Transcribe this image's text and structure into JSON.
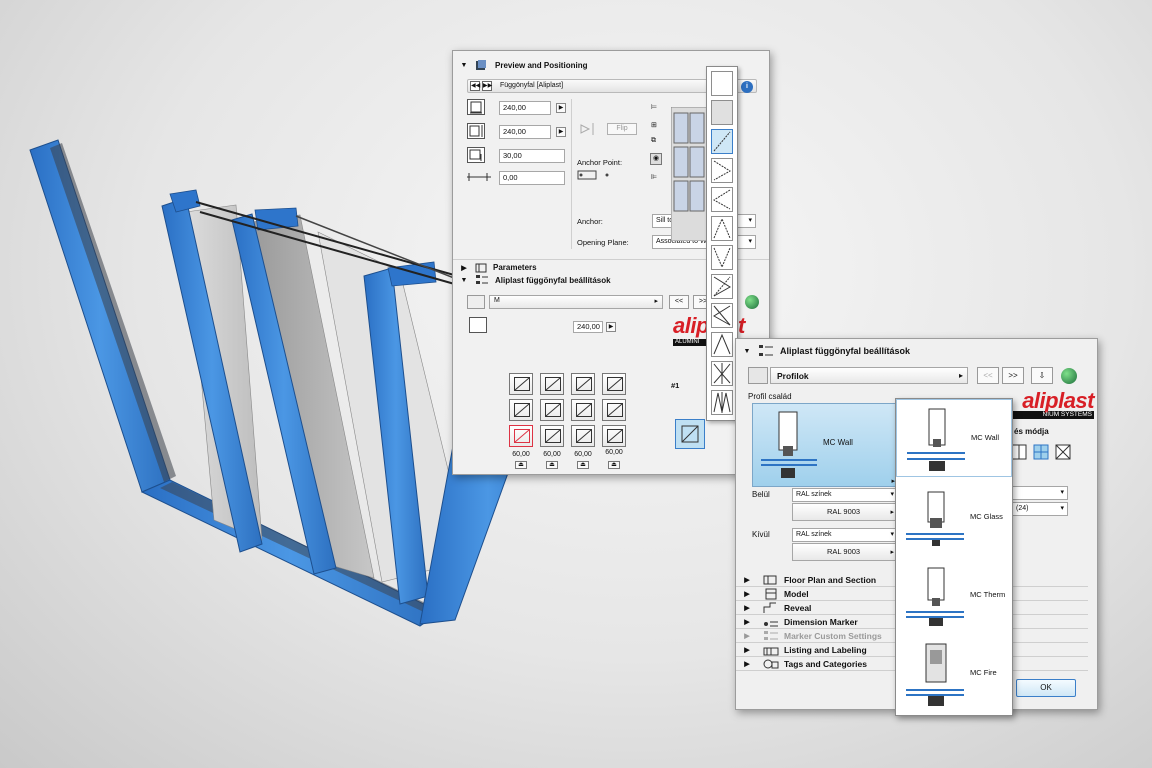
{
  "panel1": {
    "section_title": "Preview and Positioning",
    "object_name": "Függönyfal [Aliplast]",
    "width_value": "240,00",
    "height_value": "240,00",
    "depth_value": "30,00",
    "offset_value": "0,00",
    "flip_label": "Flip",
    "anchor_point_label": "Anchor Point:",
    "anchor_label": "Anchor:",
    "anchor_value": "Sill to Wall base",
    "opening_plane_label": "Opening Plane:",
    "opening_plane_value": "Associated to W",
    "parameters_label": "Parameters",
    "aliplast_settings_label": "Aliplast függönyfal beállítások",
    "height_small_value": "240,00",
    "dropdown_short": "M",
    "prev_label": "<<",
    "next_label": ">>",
    "column_widths": [
      "60,00",
      "60,00",
      "60,00",
      "60,00"
    ],
    "cell_id": "#1"
  },
  "panel2": {
    "section_title": "Aliplast függönyfal beállítások",
    "page_dropdown": "Profilok",
    "prev_label": "<<",
    "next_label": ">>",
    "profile_family_label": "Profil család",
    "selected_profile": "MC Wall",
    "inside_label": "Belül",
    "outside_label": "Kívül",
    "inside_color_set": "RAL színek",
    "inside_color": "RAL 9003",
    "outside_color_set": "RAL színek",
    "outside_color": "RAL 9003",
    "opening_mode_label_partial": "és módja",
    "partial_value": "(24)",
    "logo_text": "aliplast",
    "logo_sub": "NIUM SYSTEMS",
    "ok_label": "OK",
    "sections": [
      {
        "label": "Floor Plan and Section",
        "disabled": false
      },
      {
        "label": "Model",
        "disabled": false
      },
      {
        "label": "Reveal",
        "disabled": false
      },
      {
        "label": "Dimension Marker",
        "disabled": false
      },
      {
        "label": "Marker Custom Settings",
        "disabled": true
      },
      {
        "label": "Listing and Labeling",
        "disabled": false
      },
      {
        "label": "Tags and Categories",
        "disabled": false
      }
    ]
  },
  "profile_menu": {
    "items": [
      "MC Wall",
      "MC Glass",
      "MC Therm",
      "MC Fire"
    ]
  },
  "logo1": {
    "text": "aliplast",
    "sub": "ALUMINI"
  },
  "colors": {
    "frame_blue": "#3d86d6",
    "aliplast_red": "#d81f26",
    "selection_blue": "#9fd0ec"
  }
}
